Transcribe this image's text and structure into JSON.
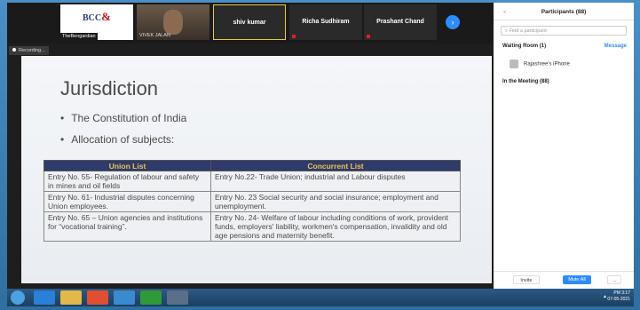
{
  "video_strip": {
    "tiles": [
      {
        "name": "",
        "caption": "TheBengardian"
      },
      {
        "name": "",
        "caption": "VIVEK JALAN"
      },
      {
        "name": "shiv kumar",
        "caption": ""
      },
      {
        "name": "Richa Sudhiram",
        "caption": ""
      },
      {
        "name": "Prashant Chand",
        "caption": ""
      }
    ],
    "logo_text": "BCC",
    "logo_amp": "&",
    "next_icon": "chevron-right-icon"
  },
  "recording_label": "Recording...",
  "slide": {
    "title": "Jurisdiction",
    "bullets": [
      "The Constitution of India",
      "Allocation of subjects:"
    ],
    "table": {
      "headers": [
        "Union List",
        "Concurrent List"
      ],
      "rows": [
        [
          "Entry No. 55- Regulation of labour and safety in mines and oil fields",
          "Entry No.22- Trade Union; industrial and Labour disputes"
        ],
        [
          "Entry No. 61- Industrial disputes concerning Union employees.",
          "Entry No. 23 Social security and social insurance; employment and unemployment."
        ],
        [
          "Entry No. 65 – Union agencies and institutions for “vocational training”.",
          "Entry No. 24- Welfare of labour including conditions of work, provident funds, employers' liability, workmen's compensation, invalidity and old age pensions and maternity benefit."
        ]
      ]
    }
  },
  "participants": {
    "title": "Participants (88)",
    "search_placeholder": "Find a participant",
    "waiting_room_label": "Waiting Room (1)",
    "message_label": "Message",
    "waiting_person": "Rajashree's iPhone",
    "in_meeting_label": "In the Meeting (88)",
    "invite_label": "Invite",
    "mute_all_label": "Mute All",
    "more_label": "..."
  },
  "taskbar": {
    "time": "PM 3:17",
    "date": "07-05-2021"
  }
}
